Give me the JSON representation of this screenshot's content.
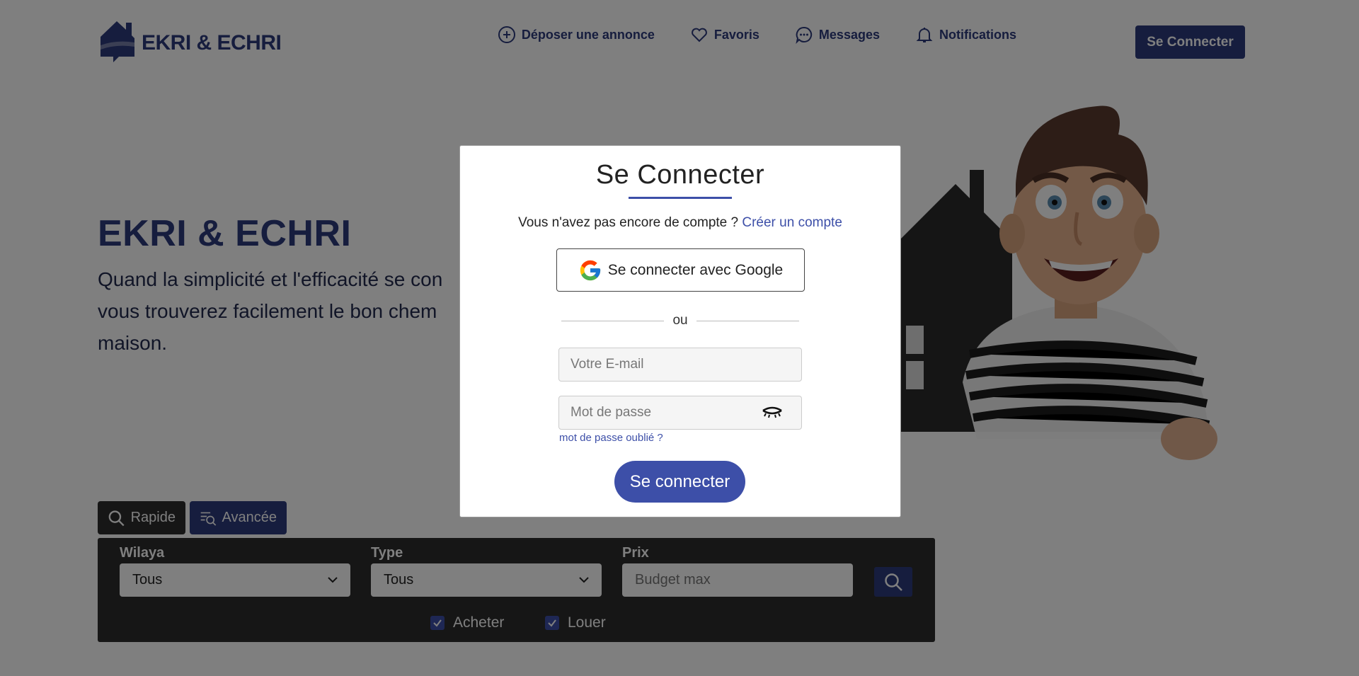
{
  "header": {
    "logo_text": "EKRI & ECHRI",
    "nav": [
      {
        "label": "Déposer une annonce",
        "icon": "plus-circle-icon"
      },
      {
        "label": "Favoris",
        "icon": "heart-icon"
      },
      {
        "label": "Messages",
        "icon": "chat-icon"
      },
      {
        "label": "Notifications",
        "icon": "bell-icon"
      }
    ],
    "login_label": "Se Connecter"
  },
  "hero": {
    "title": "EKRI & ECHRI",
    "subtitle": "Quand la simplicité et l'efficacité se con vous trouverez facilement le bon chem maison."
  },
  "search": {
    "tabs": [
      {
        "label": "Rapide",
        "icon": "search-icon"
      },
      {
        "label": "Avancée",
        "icon": "filter-search-icon"
      }
    ],
    "wilaya": {
      "label": "Wilaya",
      "value": "Tous"
    },
    "type": {
      "label": "Type",
      "value": "Tous"
    },
    "prix": {
      "label": "Prix",
      "placeholder": "Budget max"
    },
    "checks": [
      {
        "label": "Acheter",
        "checked": true
      },
      {
        "label": "Louer",
        "checked": true
      }
    ]
  },
  "modal": {
    "title": "Se Connecter",
    "no_account_text": "Vous n'avez pas encore de compte ?",
    "create_account_link": "Créer un compte",
    "google_label": "Se connecter avec Google",
    "divider_text": "ou",
    "email_placeholder": "Votre E-mail",
    "password_placeholder": "Mot de passe",
    "forgot_label": "mot de passe oublié ?",
    "submit_label": "Se connecter"
  },
  "colors": {
    "primary": "#2d3a7c",
    "accent": "#3d4fa8",
    "dark_panel": "#2c2c2c",
    "overlay": "rgba(0,0,0,0.5)"
  }
}
